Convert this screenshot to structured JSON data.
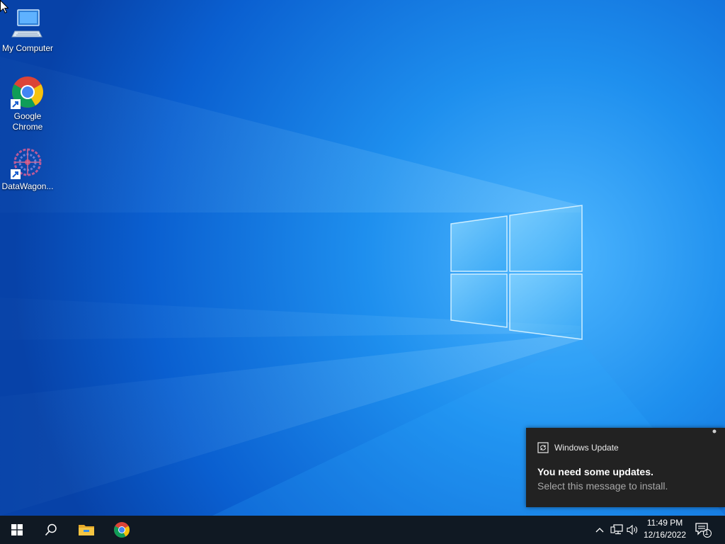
{
  "desktop": {
    "icons": [
      {
        "label": "My Computer",
        "icon": "computer-icon"
      },
      {
        "label": "Google Chrome",
        "icon": "chrome-icon"
      },
      {
        "label": "DataWagon...",
        "icon": "datawagon-icon"
      }
    ]
  },
  "taskbar": {
    "items": [
      {
        "icon": "windows-start-icon"
      },
      {
        "icon": "search-icon"
      },
      {
        "icon": "file-explorer-icon"
      },
      {
        "icon": "chrome-icon"
      }
    ],
    "tray": {
      "icons": [
        "chevron-up-icon",
        "network-icon",
        "volume-icon"
      ],
      "time": "11:49 PM",
      "date": "12/16/2022",
      "notification_count": "1"
    }
  },
  "toast": {
    "app_name": "Windows Update",
    "title": "You need some updates.",
    "body": "Select this message to install."
  },
  "colors": {
    "wallpaper_blue": "#0a5fd0",
    "taskbar": "#101923",
    "toast_bg": "#222222"
  }
}
